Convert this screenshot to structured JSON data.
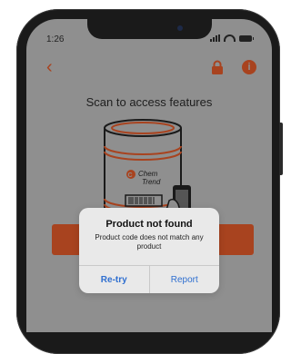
{
  "status_bar": {
    "time": "1:26"
  },
  "header": {
    "back_icon": "chevron-left-icon",
    "lock_icon": "lock-icon",
    "info_icon": "info-icon",
    "info_glyph": "i",
    "accent_color": "#a8431f"
  },
  "main": {
    "title": "Scan to access features",
    "drum_brand_line1": "Chem",
    "drum_brand_line2": "Trend"
  },
  "dialog": {
    "title": "Product not found",
    "message": "Product code does not match any product",
    "retry_label": "Re-try",
    "report_label": "Report",
    "button_color": "#2f6fd0"
  }
}
